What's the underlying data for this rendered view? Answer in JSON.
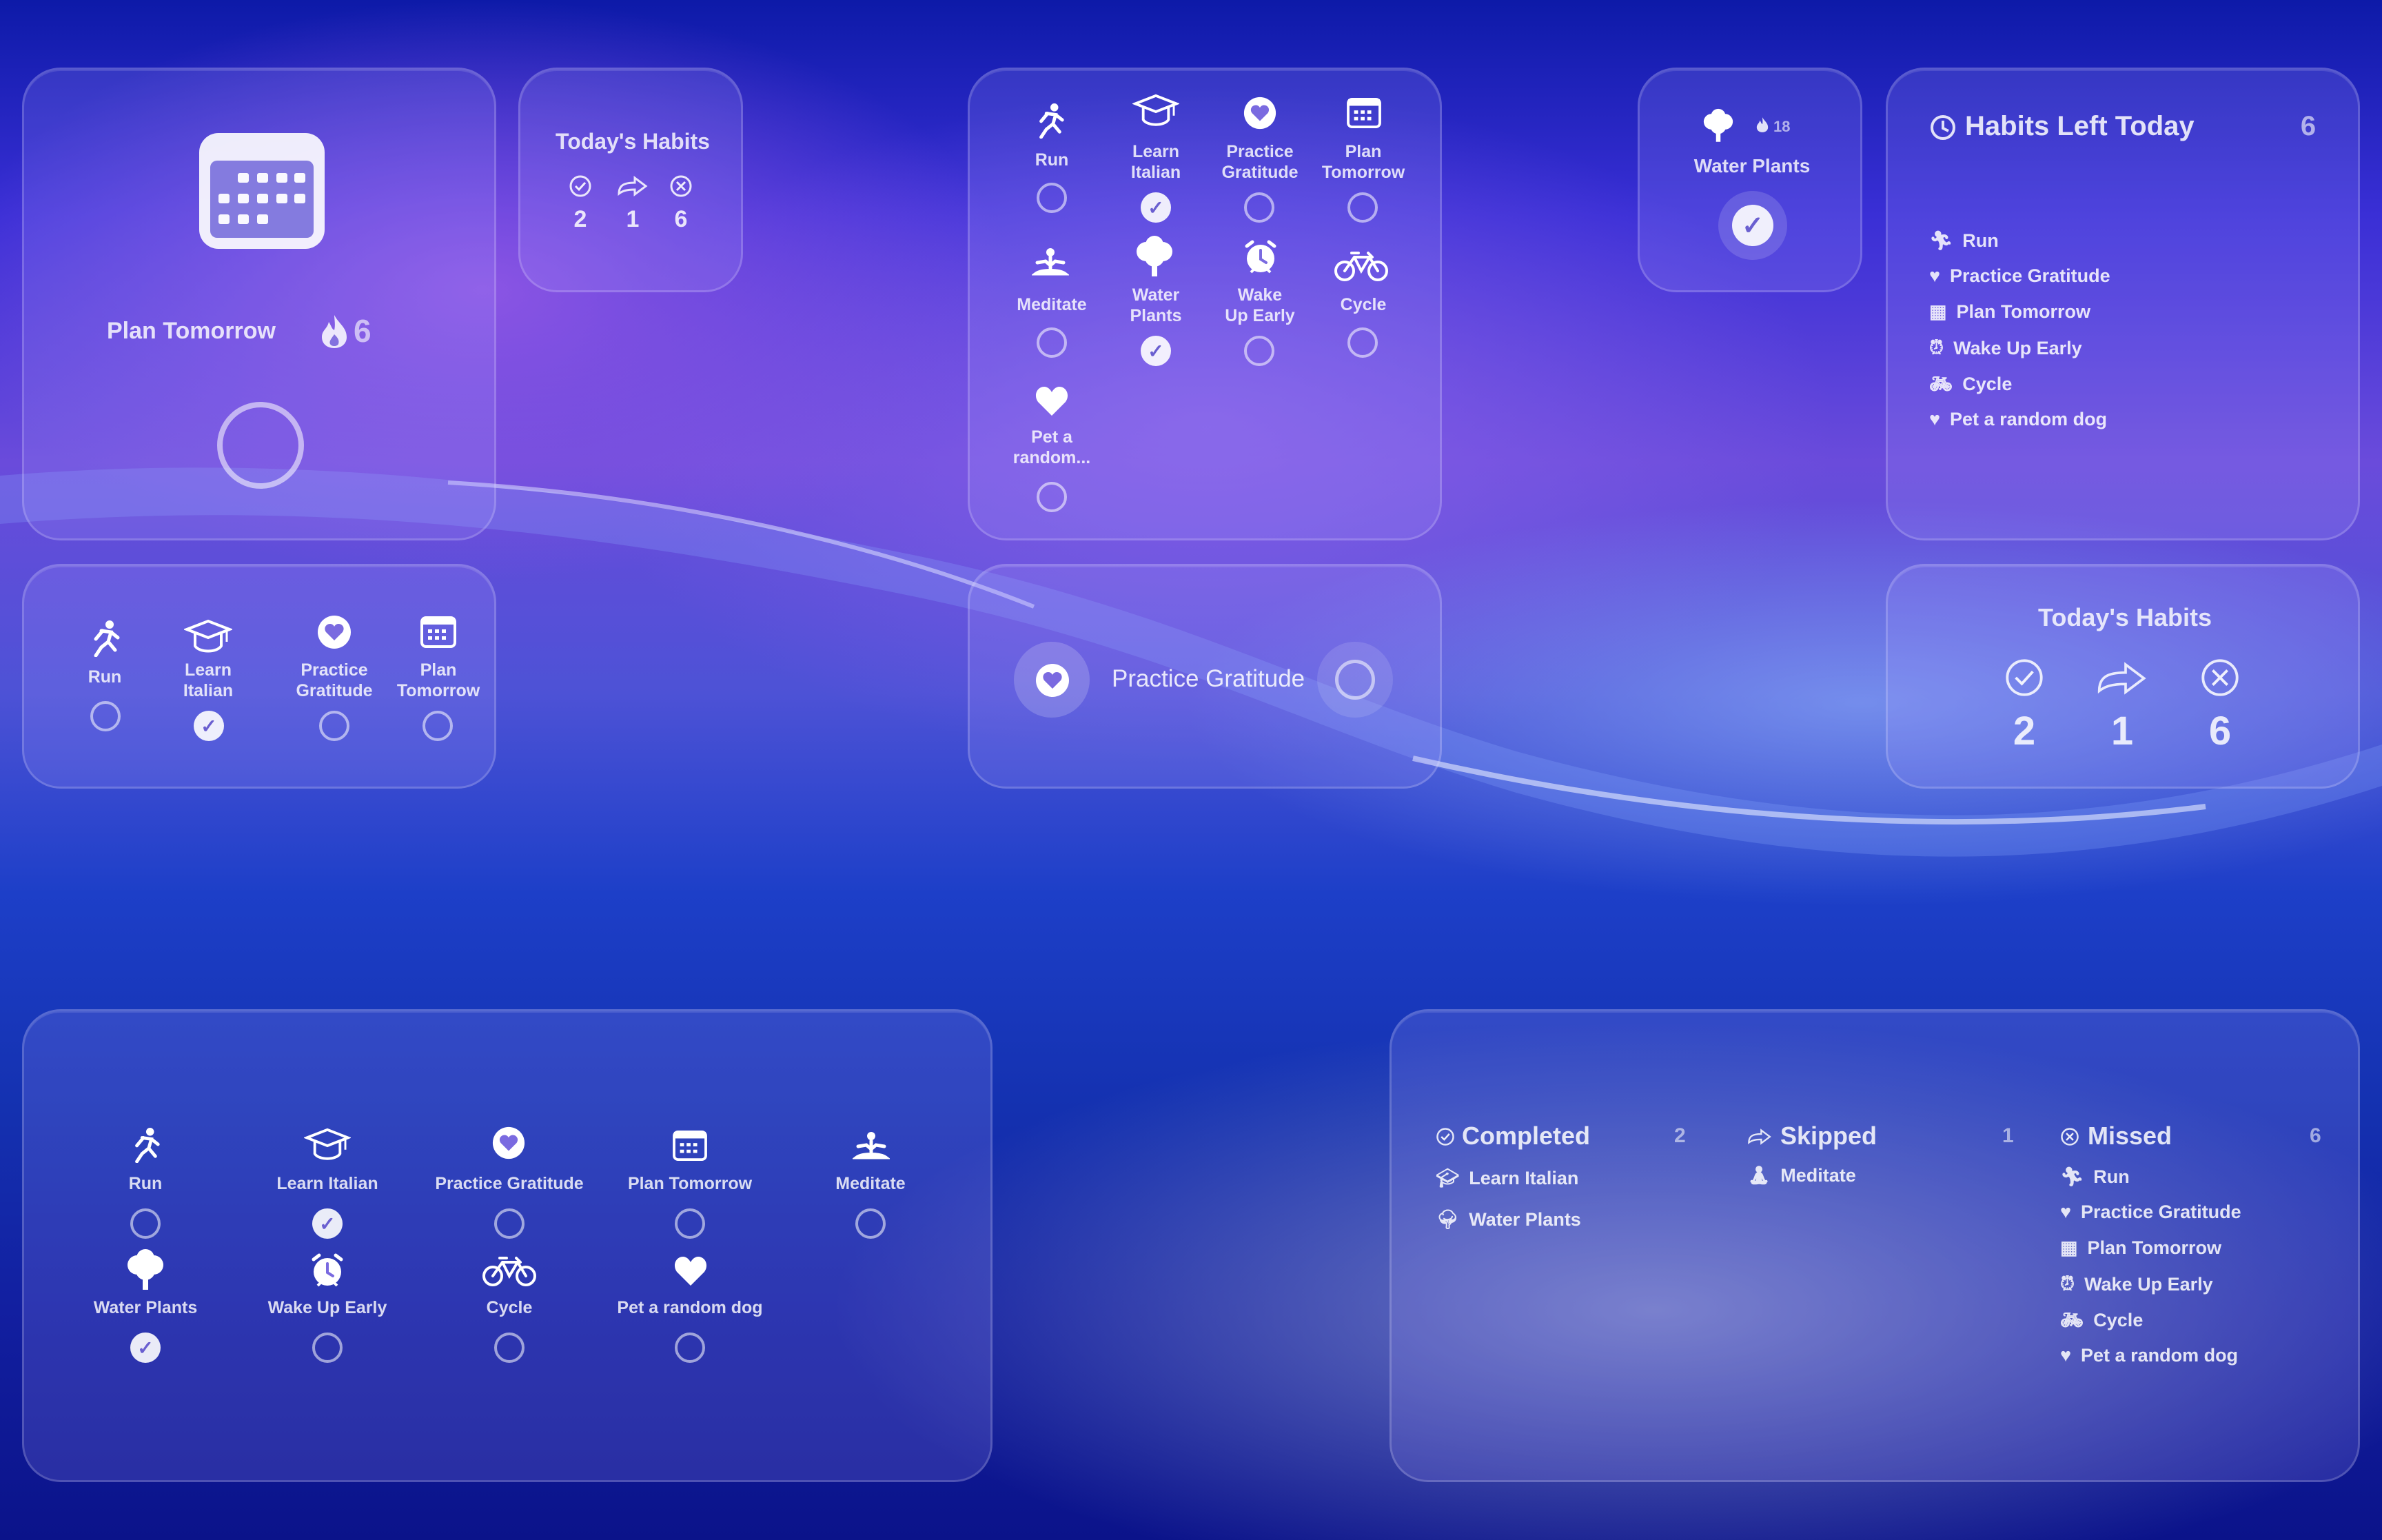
{
  "widget_plan_tomorrow": {
    "title": "Plan Tomorrow",
    "streak": "6"
  },
  "widget_today_small": {
    "title": "Today's Habits",
    "completed": "2",
    "skipped": "1",
    "missed": "6"
  },
  "widget_grid_small": {
    "items": [
      {
        "label": "Run"
      },
      {
        "label": "Learn\nItalian"
      },
      {
        "label": "Practice\nGratitude"
      },
      {
        "label": "Plan\nTomorrow"
      }
    ]
  },
  "widget_grid_large": {
    "items": [
      {
        "label": "Run"
      },
      {
        "label": "Learn\nItalian"
      },
      {
        "label": "Practice\nGratitude"
      },
      {
        "label": "Plan\nTomorrow"
      },
      {
        "label": "Meditate"
      },
      {
        "label": "Water\nPlants"
      },
      {
        "label": "Wake\nUp Early"
      },
      {
        "label": "Cycle"
      },
      {
        "label": "Pet a\nrandom..."
      }
    ]
  },
  "widget_practice_gratitude": {
    "label": "Practice Gratitude"
  },
  "widget_water_plants": {
    "label": "Water Plants",
    "streak": "18"
  },
  "widget_habits_left": {
    "title": "Habits Left Today",
    "count": "6",
    "items": [
      "Run",
      "Practice Gratitude",
      "Plan Tomorrow",
      "Wake Up Early",
      "Cycle",
      "Pet a random dog"
    ]
  },
  "widget_today_medium": {
    "title": "Today's Habits",
    "completed": "2",
    "skipped": "1",
    "missed": "6"
  },
  "widget_grid_wide": {
    "items": [
      {
        "label": "Run"
      },
      {
        "label": "Learn Italian"
      },
      {
        "label": "Practice Gratitude"
      },
      {
        "label": "Plan Tomorrow"
      },
      {
        "label": "Meditate"
      },
      {
        "label": "Water Plants"
      },
      {
        "label": "Wake Up Early"
      },
      {
        "label": "Cycle"
      },
      {
        "label": "Pet a random dog"
      }
    ]
  },
  "widget_summary": {
    "completed": {
      "title": "Completed",
      "count": "2",
      "items": [
        "Learn Italian",
        "Water Plants"
      ]
    },
    "skipped": {
      "title": "Skipped",
      "count": "1",
      "items": [
        "Meditate"
      ]
    },
    "missed": {
      "title": "Missed",
      "count": "6",
      "items": [
        "Run",
        "Practice Gratitude",
        "Plan Tomorrow",
        "Wake Up Early",
        "Cycle",
        "Pet a random dog"
      ]
    }
  }
}
